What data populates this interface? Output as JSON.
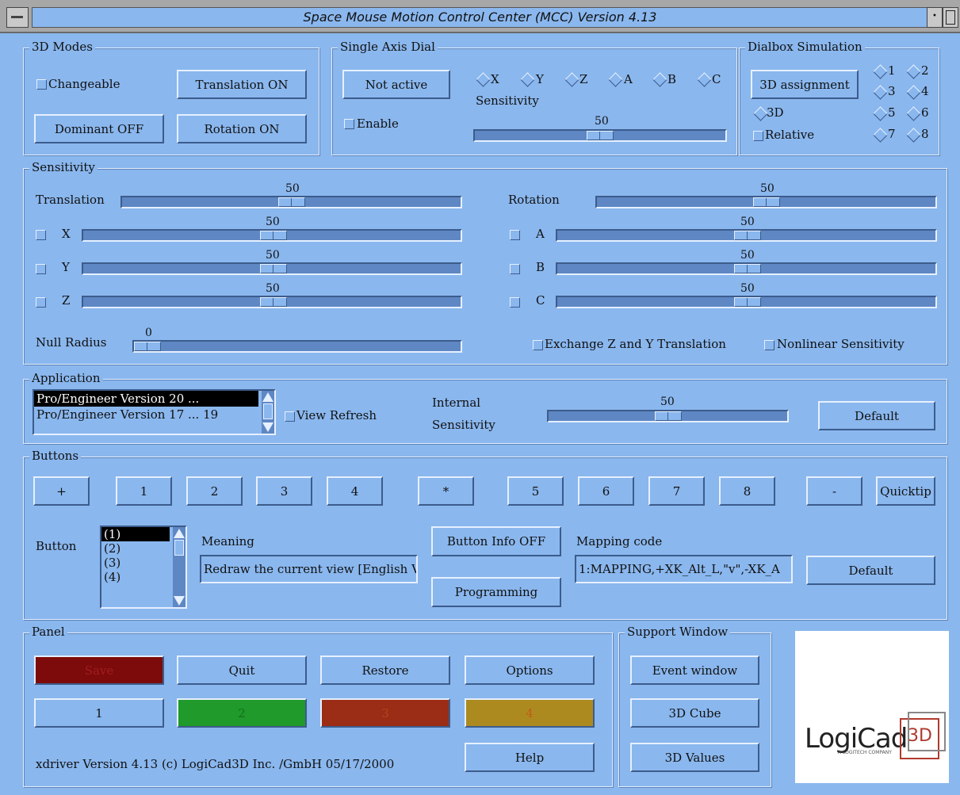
{
  "window": {
    "title": "Space Mouse  Motion Control Center (MCC) Version 4.13",
    "min_glyph": "•"
  },
  "modes": {
    "title": "3D Modes",
    "changeable": "Changeable",
    "translation_btn": "Translation ON",
    "dominant_btn": "Dominant OFF",
    "rotation_btn": "Rotation ON"
  },
  "single_axis": {
    "title": "Single Axis Dial",
    "not_active_btn": "Not active",
    "axes": [
      "X",
      "Y",
      "Z",
      "A",
      "B",
      "C"
    ],
    "sensitivity_label": "Sensitivity",
    "enable": "Enable",
    "value": "50"
  },
  "dialbox": {
    "title": "Dialbox Simulation",
    "assign_btn": "3D assignment",
    "opt_3d": "3D",
    "relative": "Relative",
    "numbers": [
      "1",
      "2",
      "3",
      "4",
      "5",
      "6",
      "7",
      "8"
    ]
  },
  "sensitivity": {
    "title": "Sensitivity",
    "translation": "Translation",
    "rotation": "Rotation",
    "translation_value": "50",
    "rotation_value": "50",
    "x": "X",
    "y": "Y",
    "z": "Z",
    "a": "A",
    "b": "B",
    "c": "C",
    "x_value": "50",
    "y_value": "50",
    "z_value": "50",
    "a_value": "50",
    "b_value": "50",
    "c_value": "50",
    "null_radius": "Null Radius",
    "null_value": "0",
    "exchange": "Exchange Z and Y Translation",
    "nonlinear": "Nonlinear Sensitivity"
  },
  "application": {
    "title": "Application",
    "items": [
      "Pro/Engineer Version 20 ...",
      "Pro/Engineer Version 17 ... 19"
    ],
    "view_refresh": "View Refresh",
    "internal": "Internal",
    "sensitivity": "Sensitivity",
    "value": "50",
    "default_btn": "Default"
  },
  "buttons": {
    "title": "Buttons",
    "keys": [
      "+",
      "1",
      "2",
      "3",
      "4",
      "*",
      "5",
      "6",
      "7",
      "8",
      "-"
    ],
    "quicktip": "Quicktip",
    "button_label": "Button",
    "list": [
      "(1)",
      "(2)",
      "(3)",
      "(4)"
    ],
    "meaning_label": "Meaning",
    "meaning_value": "Redraw the current view [English Versi",
    "info_btn": "Button Info OFF",
    "programming_btn": "Programming",
    "mapping_label": "Mapping code",
    "mapping_value": "1:MAPPING,+XK_Alt_L,\"v\",-XK_A",
    "default_btn": "Default"
  },
  "panel": {
    "title": "Panel",
    "save": "Save",
    "quit": "Quit",
    "restore": "Restore",
    "options": "Options",
    "p1": "1",
    "p2": "2",
    "p3": "3",
    "p4": "4",
    "help": "Help",
    "footer": "xdriver Version 4.13  (c) LogiCad3D Inc. /GmbH 05/17/2000"
  },
  "support": {
    "title": "Support Window",
    "event_btn": "Event window",
    "cube_btn": "3D Cube",
    "values_btn": "3D Values"
  },
  "logo": {
    "text": "LogiCad",
    "mark": "3D",
    "tagline": "A LOGITECH COMPANY"
  }
}
